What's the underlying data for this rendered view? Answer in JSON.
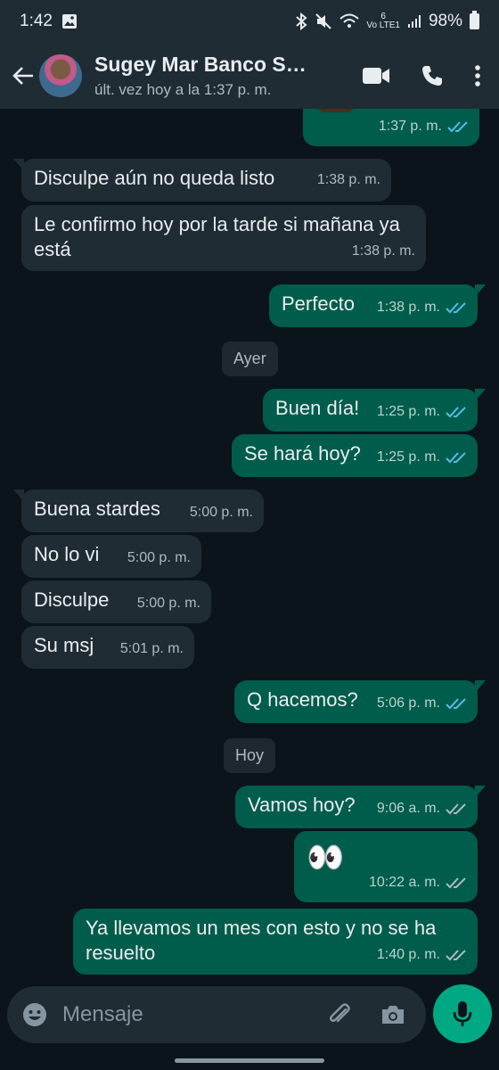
{
  "status_bar": {
    "time": "1:42",
    "network_label": "Vo LTE1",
    "signal_label": "6",
    "battery": "98%"
  },
  "header": {
    "contact_name": "Sugey Mar Banco S…",
    "last_seen": "últ. vez hoy a la 1:37 p. m."
  },
  "messages": [
    {
      "dir": "out",
      "text": "",
      "time": "1:37 p. m.",
      "status": "read"
    },
    {
      "dir": "in",
      "text": "Disculpe  aún no queda listo",
      "time": "1:38 p. m."
    },
    {
      "dir": "in",
      "text": "Le confirmo hoy por la tarde si mañana ya está",
      "time": "1:38 p. m."
    },
    {
      "dir": "out",
      "text": "Perfecto",
      "time": "1:38 p. m.",
      "status": "read"
    },
    {
      "dir": "out",
      "text": "Buen día!",
      "time": "1:25 p. m.",
      "status": "read"
    },
    {
      "dir": "out",
      "text": "Se hará hoy?",
      "time": "1:25 p. m.",
      "status": "read"
    },
    {
      "dir": "in",
      "text": "Buena stardes",
      "time": "5:00 p. m."
    },
    {
      "dir": "in",
      "text": "No lo vi",
      "time": "5:00 p. m."
    },
    {
      "dir": "in",
      "text": "Disculpe",
      "time": "5:00 p. m."
    },
    {
      "dir": "in",
      "text": "Su msj",
      "time": "5:01 p. m."
    },
    {
      "dir": "out",
      "text": "Q hacemos?",
      "time": "5:06 p. m.",
      "status": "read"
    },
    {
      "dir": "out",
      "text": "Vamos hoy?",
      "time": "9:06 a. m.",
      "status": "delivered"
    },
    {
      "dir": "out",
      "text": "👀",
      "time": "10:22 a. m.",
      "status": "delivered"
    },
    {
      "dir": "out",
      "text": "Ya llevamos un mes con esto y no se ha resuelto",
      "time": "1:40 p. m.",
      "status": "delivered"
    }
  ],
  "date_separators": [
    "Ayer",
    "Hoy"
  ],
  "composer": {
    "placeholder": "Mensaje"
  },
  "colors": {
    "read_tick": "#53bdeb",
    "delivered_tick": "#aebac1",
    "accent": "#00a884"
  },
  "icons": [
    "back-arrow-icon",
    "video-call-icon",
    "voice-call-icon",
    "more-options-icon",
    "emoji-icon",
    "attach-icon",
    "camera-icon",
    "mic-icon"
  ]
}
